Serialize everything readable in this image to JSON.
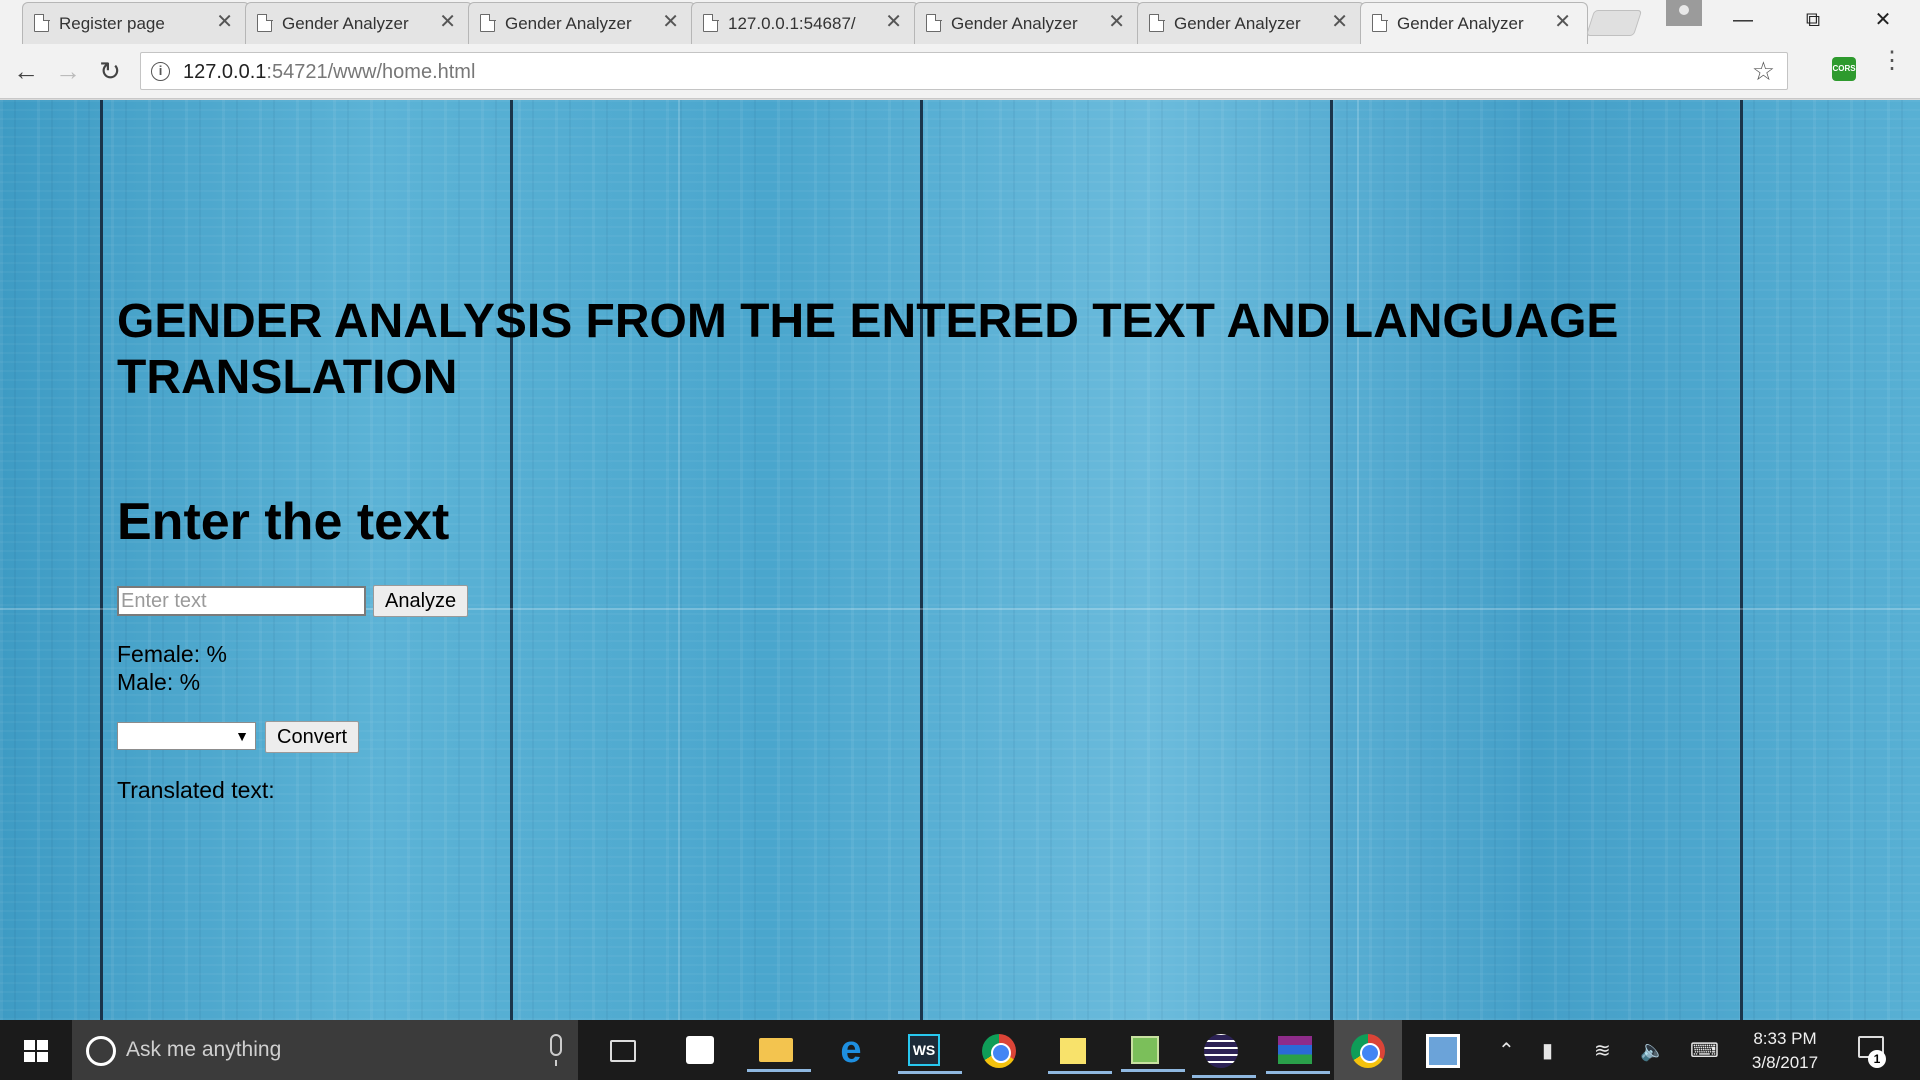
{
  "browser": {
    "tabs": [
      {
        "title": "Register page",
        "active": false
      },
      {
        "title": "Gender Analyzer",
        "active": false
      },
      {
        "title": "Gender Analyzer",
        "active": false
      },
      {
        "title": "127.0.0.1:54687/",
        "active": false
      },
      {
        "title": "Gender Analyzer",
        "active": false
      },
      {
        "title": "Gender Analyzer",
        "active": false
      },
      {
        "title": "Gender Analyzer",
        "active": true
      }
    ],
    "tab_close_glyph": "✕",
    "url_host": "127.0.0.1",
    "url_rest": ":54721/www/home.html",
    "extension_label": "CORS",
    "icons": {
      "back": "back-arrow-icon",
      "forward": "forward-arrow-icon",
      "reload": "reload-icon",
      "info": "info-icon",
      "bookmark": "star-icon",
      "menu": "menu-dots-icon"
    }
  },
  "page": {
    "title": "GENDER ANALYSIS FROM THE ENTERED TEXT AND LANGUAGE TRANSLATION",
    "subtitle": "Enter the text",
    "input_placeholder": "Enter text",
    "input_value": "",
    "analyze_label": "Analyze",
    "female_label": "Female: %",
    "male_label": "Male: %",
    "language_select_value": "",
    "convert_label": "Convert",
    "translated_label": "Translated text:"
  },
  "taskbar": {
    "search_placeholder": "Ask me anything",
    "clock_time": "8:33 PM",
    "clock_date": "3/8/2017",
    "notification_count": "1",
    "ws_label": "WS",
    "edge_glyph": "e"
  },
  "colors": {
    "page_background": "#4aa7cd",
    "taskbar": "#1b1b1b",
    "extension_green": "#2e9a2e"
  }
}
